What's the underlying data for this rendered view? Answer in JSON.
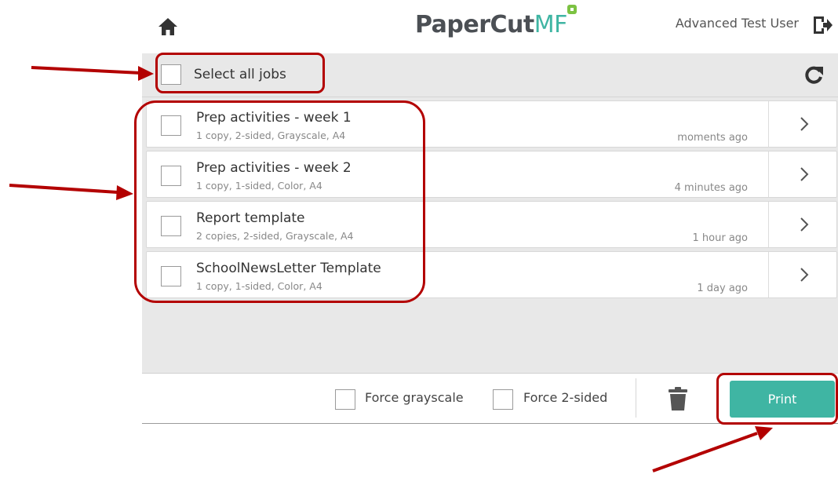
{
  "header": {
    "logo_main": "PaperCut",
    "logo_suffix": "MF",
    "user_name": "Advanced Test User"
  },
  "select_bar": {
    "select_all_label": "Select all jobs"
  },
  "jobs": [
    {
      "title": "Prep activities - week 1",
      "details": "1 copy, 2-sided, Grayscale, A4",
      "time": "moments ago"
    },
    {
      "title": "Prep activities - week 2",
      "details": "1 copy, 1-sided, Color, A4",
      "time": "4 minutes ago"
    },
    {
      "title": "Report template",
      "details": "2 copies, 2-sided, Grayscale, A4",
      "time": "1 hour ago"
    },
    {
      "title": "SchoolNewsLetter Template",
      "details": "1 copy, 1-sided, Color, A4",
      "time": "1 day ago"
    }
  ],
  "bottom_bar": {
    "force_grayscale_label": "Force grayscale",
    "force_2sided_label": "Force 2-sided",
    "print_label": "Print"
  },
  "colors": {
    "accent": "#3fb5a3",
    "annotation": "#b30000",
    "panel_gray": "#e8e8e8"
  },
  "icons": [
    "home-icon",
    "logout-icon",
    "refresh-icon",
    "chevron-right-icon",
    "trash-icon"
  ]
}
